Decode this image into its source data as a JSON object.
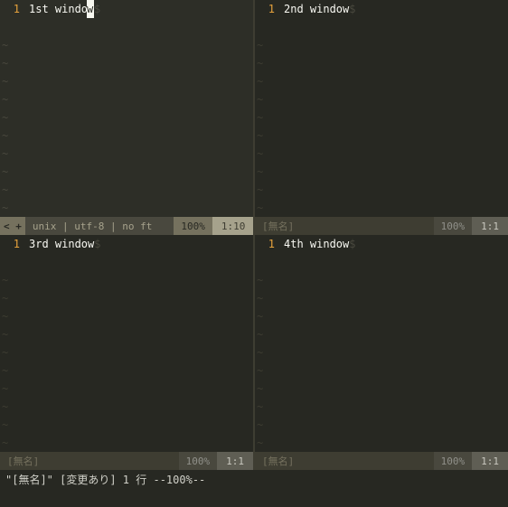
{
  "panes": {
    "tl": {
      "lineno": "1",
      "text_pre": "1st windo",
      "cursor_char": "w",
      "text_post": "",
      "eol": "$"
    },
    "tr": {
      "lineno": "1",
      "text": "2nd window",
      "eol": "$"
    },
    "bl": {
      "lineno": "1",
      "text": "3rd window",
      "eol": "$"
    },
    "br": {
      "lineno": "1",
      "text": "4th window",
      "eol": "$"
    }
  },
  "status": {
    "active": {
      "mode_indicator": "< +",
      "fileinfo": "unix | utf-8 | no ft",
      "percent": "100%",
      "position": "1:10"
    },
    "inactive": {
      "name": "[無名]",
      "percent": "100%",
      "position": "1:1"
    }
  },
  "cmdline": "\"[無名]\" [変更あり] 1 行 --100%--",
  "tilde": "~"
}
